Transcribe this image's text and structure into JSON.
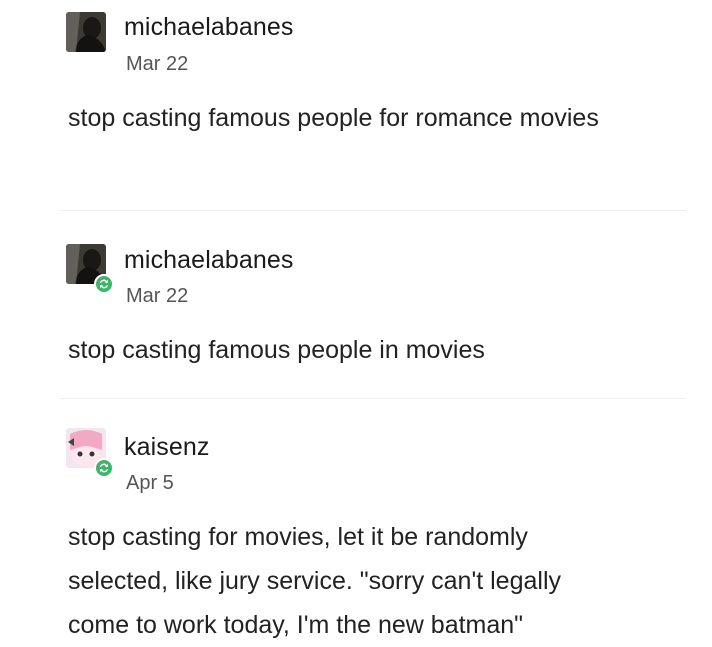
{
  "posts": [
    {
      "username": "michaelabanes",
      "date": "Mar 22",
      "body": "stop casting famous people for romance movies",
      "reblog": false,
      "avatar": "dark-portrait-avatar"
    },
    {
      "username": "michaelabanes",
      "date": "Mar 22",
      "body": "stop casting famous people in movies",
      "reblog": true,
      "avatar": "dark-portrait-avatar"
    },
    {
      "username": "kaisenz",
      "date": "Apr 5",
      "body_lines": [
        "stop casting for movies, let it be randomly",
        "selected, like jury service. \"sorry can't legally",
        "come to work today, I'm the new batman\""
      ],
      "reblog": true,
      "avatar": "anime-pink-avatar"
    }
  ],
  "colors": {
    "reblog_badge": "#3fb46b",
    "divider": "#eeeeee"
  }
}
